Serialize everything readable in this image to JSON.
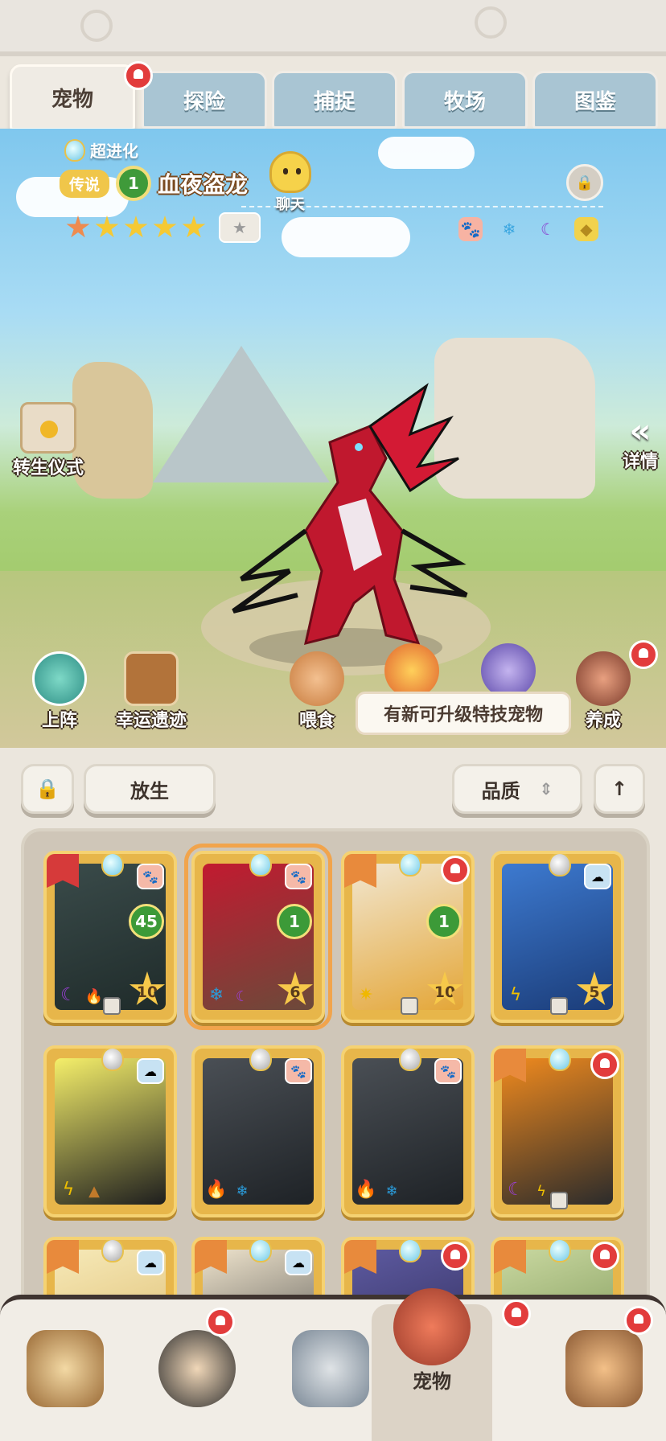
{
  "tabs": [
    "宠物",
    "探险",
    "捕捉",
    "牧场",
    "图鉴"
  ],
  "pet": {
    "evolution": "超进化",
    "rarity": "传说",
    "level": "1",
    "name": "血夜盗龙",
    "stars_total": 5
  },
  "chat_label": "聊天",
  "left_action": "转生仪式",
  "right_action": "详情",
  "detail_arrows": "«",
  "actions": {
    "deploy": "上阵",
    "lucky": "幸运遗迹",
    "feed": "喂食",
    "raise": "养成"
  },
  "tooltip": "有新可升级特技宠物",
  "controls": {
    "release": "放生",
    "sort": "品质",
    "sort_arrows": "⇕",
    "up": "↑"
  },
  "cards": [
    {
      "level": "45",
      "stars": "10"
    },
    {
      "level": "1",
      "stars": "6"
    },
    {
      "level": "1",
      "stars": "10"
    },
    {
      "level": "",
      "stars": "5"
    }
  ],
  "nav_active_label": "宠物",
  "colors": {
    "card_gold": "#e7b64a",
    "level_green": "#3c9a38",
    "bell_red": "#e23c3c",
    "tab_blue": "#a9c5d3"
  }
}
